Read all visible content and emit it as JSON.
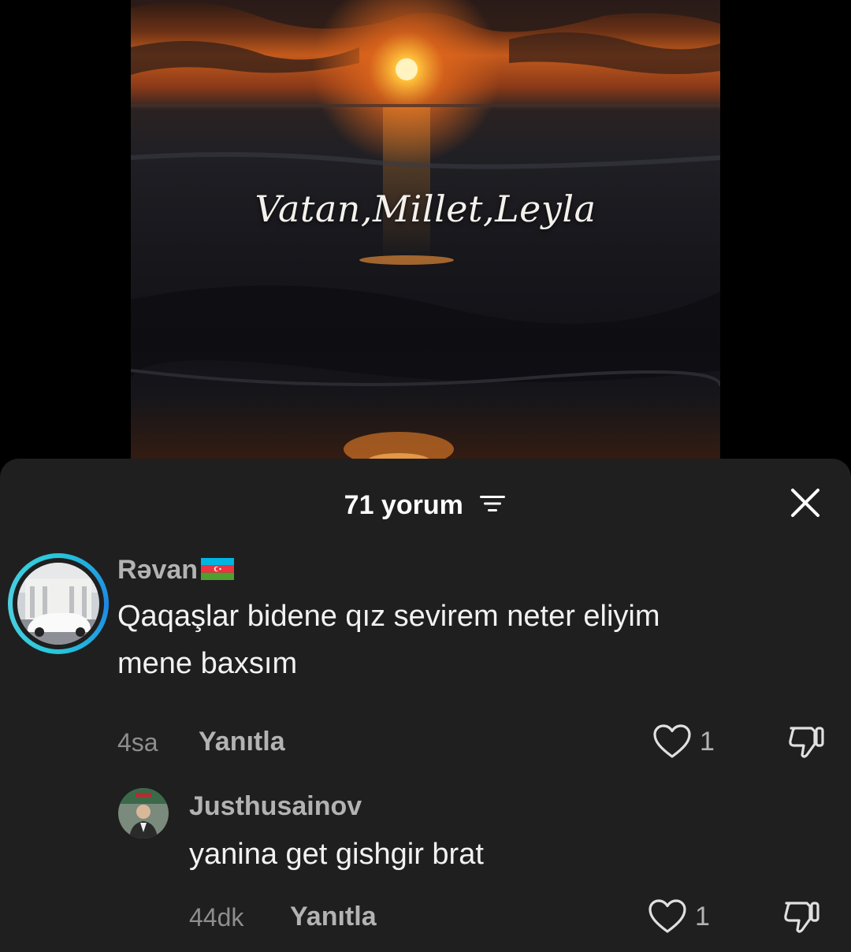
{
  "video": {
    "caption": "Vatan,Millet,Leyla"
  },
  "comments_sheet": {
    "title": "71 yorum",
    "filter_icon": "filter-icon",
    "close_icon": "close-icon"
  },
  "comments": [
    {
      "username": "Rəvan",
      "flag": "azerbaijan-flag",
      "text_line1": "Qaqaşlar bidene qız sevirem neter eliyim",
      "text_line2": "mene baxsım",
      "time": "4sa",
      "reply_label": "Yanıtla",
      "likes": "1"
    },
    {
      "username": "Justhusainov",
      "text": "yanina get gishgir brat",
      "time": "44dk",
      "reply_label": "Yanıtla",
      "likes": "1"
    }
  ],
  "colors": {
    "sheet_bg": "#1f1f1f",
    "story_ring": "#26c6da",
    "text_primary": "#f2f2f2",
    "text_secondary": "#b3b3b3"
  }
}
